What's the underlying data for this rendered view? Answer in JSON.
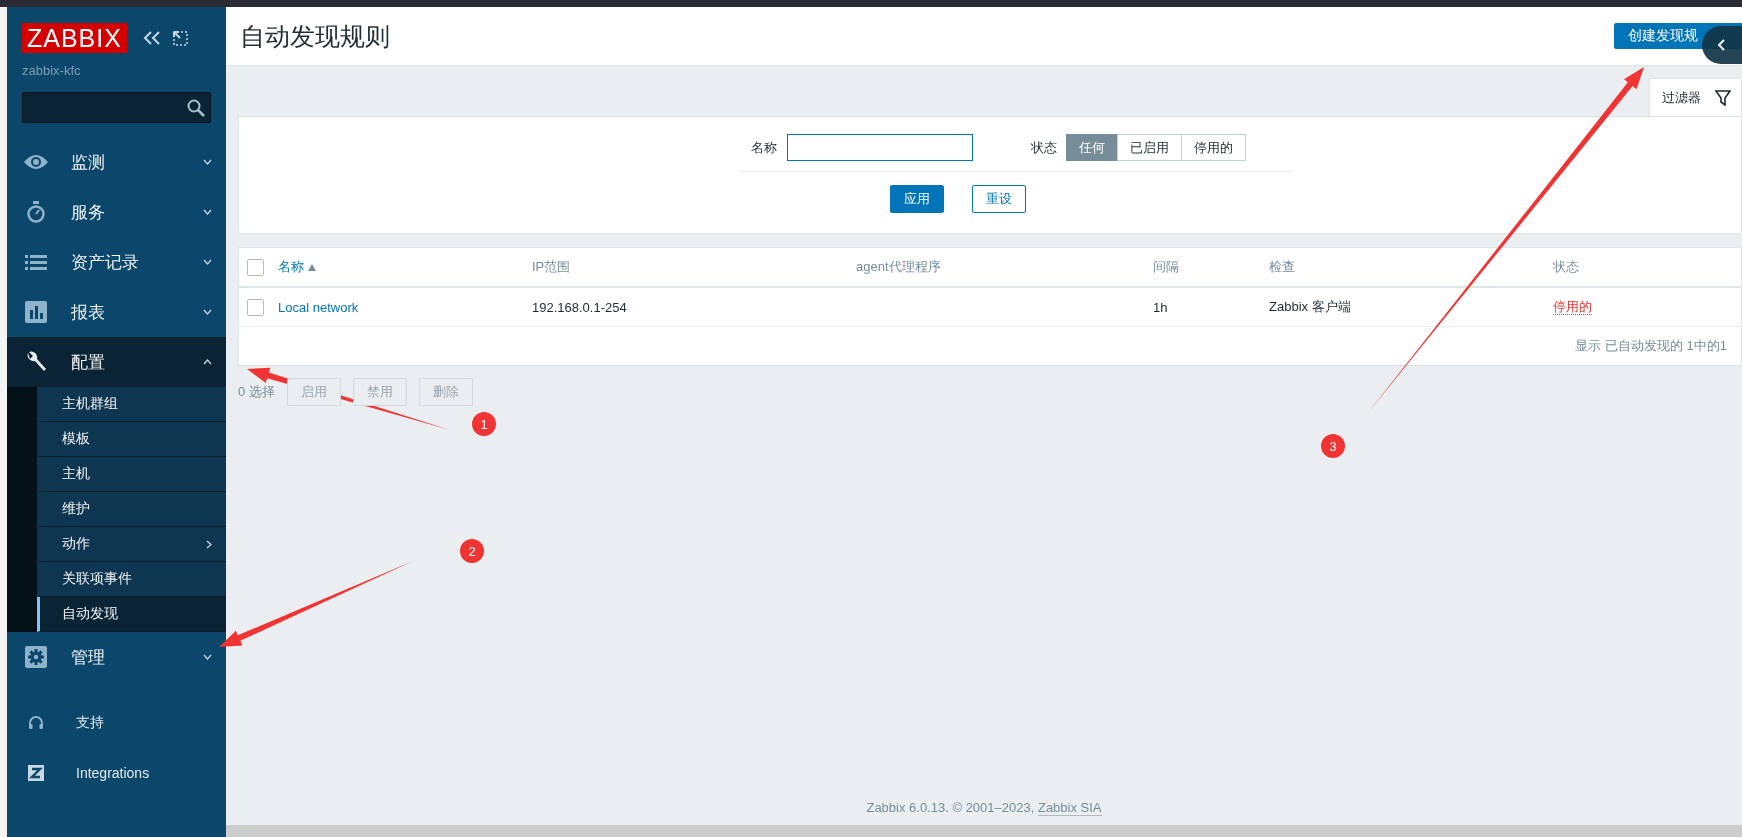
{
  "sidebar": {
    "logo": "ZABBIX",
    "server": "zabbix-kfc",
    "menu": [
      {
        "label": "监测",
        "expanded": false
      },
      {
        "label": "服务",
        "expanded": false
      },
      {
        "label": "资产记录",
        "expanded": false
      },
      {
        "label": "报表",
        "expanded": false
      },
      {
        "label": "配置",
        "expanded": true,
        "children": [
          {
            "label": "主机群组",
            "selected": false,
            "has_submenu": false
          },
          {
            "label": "模板",
            "selected": false,
            "has_submenu": false
          },
          {
            "label": "主机",
            "selected": false,
            "has_submenu": false
          },
          {
            "label": "维护",
            "selected": false,
            "has_submenu": false
          },
          {
            "label": "动作",
            "selected": false,
            "has_submenu": true
          },
          {
            "label": "关联项事件",
            "selected": false,
            "has_submenu": false
          },
          {
            "label": "自动发现",
            "selected": true,
            "has_submenu": false
          }
        ]
      },
      {
        "label": "管理",
        "expanded": false
      }
    ],
    "bottom_menu": [
      {
        "label": "支持"
      },
      {
        "label": "Integrations"
      }
    ]
  },
  "header": {
    "title": "自动发现规则",
    "create_button": "创建发现规",
    "filter_tab": "过滤器"
  },
  "filter": {
    "name_label": "名称",
    "status_label": "状态",
    "status_options": [
      {
        "label": "任何",
        "selected": true
      },
      {
        "label": "已启用",
        "selected": false
      },
      {
        "label": "停用的",
        "selected": false
      }
    ],
    "apply": "应用",
    "reset": "重设"
  },
  "table": {
    "select_all_checked": false,
    "columns": [
      {
        "label": "名称",
        "sorted": true
      },
      {
        "label": "IP范围",
        "sorted": false
      },
      {
        "label": "agent代理程序",
        "sorted": false
      },
      {
        "label": "间隔",
        "sorted": false
      },
      {
        "label": "检查",
        "sorted": false
      },
      {
        "label": "状态",
        "sorted": false
      }
    ],
    "rows": [
      {
        "checked": false,
        "name": "Local network",
        "ip_range": "192.168.0.1-254",
        "interval": "1h",
        "checks": "Zabbix 客户端",
        "status": {
          "text": "停用的",
          "kind": "disabled"
        }
      }
    ],
    "summary": "显示 已自动发现的 1中的1"
  },
  "actions": {
    "selected_count": "0 选择",
    "buttons": [
      {
        "label": "启用",
        "disabled": true
      },
      {
        "label": "禁用",
        "disabled": true
      },
      {
        "label": "删除",
        "disabled": true
      }
    ]
  },
  "footer": {
    "text": "Zabbix 6.0.13. © 2001–2023,",
    "link": "Zabbix SIA"
  },
  "annotations": [
    {
      "label": "1"
    },
    {
      "label": "2"
    },
    {
      "label": "3"
    }
  ]
}
